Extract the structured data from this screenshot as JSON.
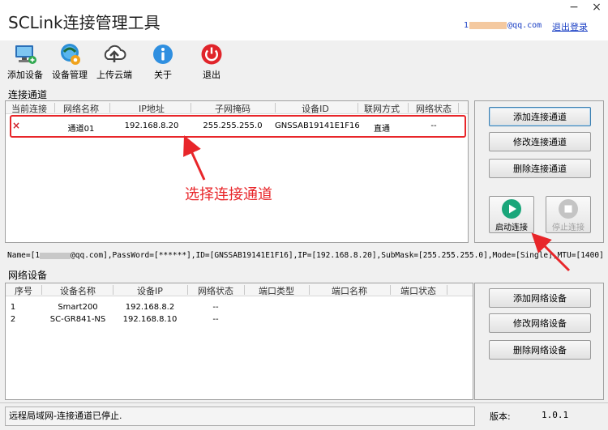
{
  "window": {
    "title": "SCLink连接管理工具",
    "minimize_glyph": "−",
    "close_glyph": "×",
    "user_email_prefix": "1",
    "user_email_suffix": "@qq.com",
    "logout_label": "退出登录"
  },
  "toolbar": {
    "items": [
      {
        "label": "添加设备",
        "icon": "add-device-icon"
      },
      {
        "label": "设备管理",
        "icon": "device-manage-icon"
      },
      {
        "label": "上传云端",
        "icon": "upload-cloud-icon"
      },
      {
        "label": "关于",
        "icon": "info-icon"
      },
      {
        "label": "退出",
        "icon": "power-icon"
      }
    ]
  },
  "channels": {
    "group_label": "连接通道",
    "columns": [
      "当前连接",
      "网络名称",
      "IP地址",
      "子网掩码",
      "设备ID",
      "联网方式",
      "网络状态"
    ],
    "rows": [
      {
        "status_icon": "×",
        "name": "通道01",
        "ip": "192.168.8.20",
        "mask": "255.255.255.0",
        "device_id": "GNSSAB19141E1F16",
        "mode": "直通",
        "net_status": "--"
      }
    ],
    "buttons": {
      "add": "添加连接通道",
      "edit": "修改连接通道",
      "delete": "删除连接通道",
      "start": "启动连接",
      "stop": "停止连接"
    }
  },
  "params_line": {
    "prefix": "Name=[1",
    "suffix": "@qq.com],PassWord=[******],ID=[GNSSAB19141E1F16],IP=[192.168.8.20],SubMask=[255.255.255.0],Mode=[Single],MTU=[1400]"
  },
  "devices": {
    "group_label": "网络设备",
    "columns": [
      "序号",
      "设备名称",
      "设备IP",
      "网络状态",
      "端口类型",
      "端口名称",
      "端口状态"
    ],
    "rows": [
      {
        "index": "1",
        "name": "Smart200",
        "ip": "192.168.8.2",
        "net_status": "--"
      },
      {
        "index": "2",
        "name": "SC-GR841-NS",
        "ip": "192.168.8.10",
        "net_status": "--"
      }
    ],
    "buttons": {
      "add": "添加网络设备",
      "edit": "修改网络设备",
      "delete": "删除网络设备"
    }
  },
  "status": {
    "message": "远程局域网-连接通道已停止.",
    "version_label": "版本:",
    "version_value": "1.0.1"
  },
  "annotation": {
    "text": "选择连接通道",
    "color": "#e8262a"
  },
  "colors": {
    "link": "#1a3fc4",
    "annotation_red": "#e8262a",
    "start_green": "#1aa67a",
    "power_red": "#e0242a"
  }
}
